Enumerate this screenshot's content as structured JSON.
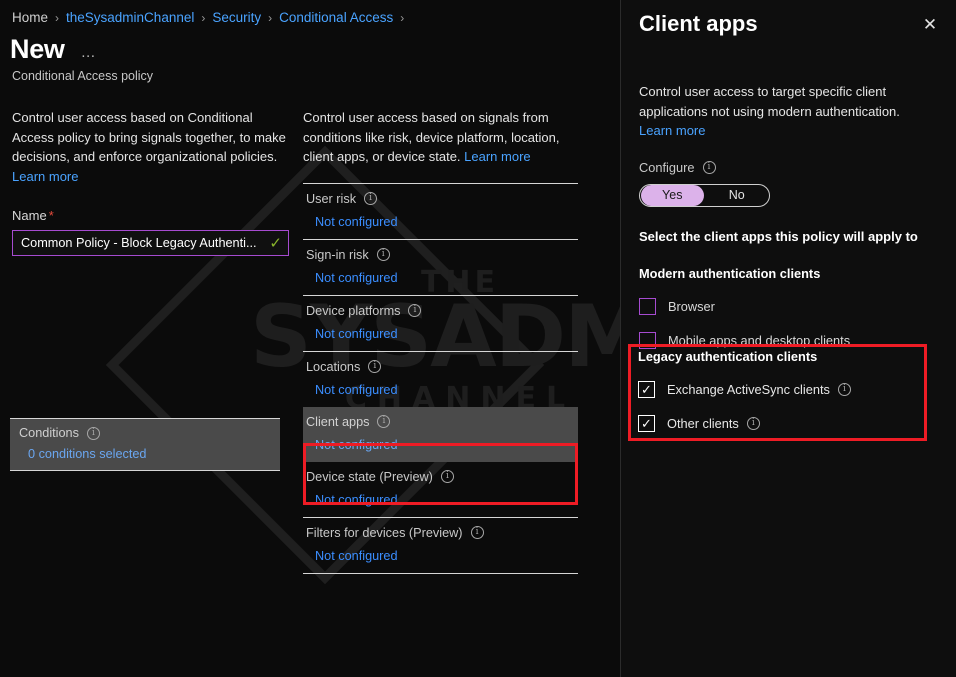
{
  "breadcrumb": {
    "items": [
      {
        "label": "Home",
        "type": "current"
      },
      {
        "label": "theSysadminChannel",
        "type": "link"
      },
      {
        "label": "Security",
        "type": "link"
      },
      {
        "label": "Conditional Access",
        "type": "link"
      }
    ],
    "separator": "›"
  },
  "page": {
    "title": "New",
    "subtitle": "Conditional Access policy",
    "overflow_menu": "…"
  },
  "left_column": {
    "intro": "Control user access based on Conditional Access policy to bring signals together, to make decisions, and enforce organizational policies.",
    "intro_link": "Learn more",
    "name_label": "Name",
    "name_required_mark": "*",
    "name_value": "Common Policy - Block Legacy Authenti...",
    "name_valid_icon": "✓",
    "conditions": {
      "title": "Conditions",
      "value": "0 conditions selected",
      "info_icon": "i"
    }
  },
  "middle_column": {
    "intro": "Control user access based on signals from conditions like risk, device platform, location, client apps, or device state.",
    "intro_link": "Learn more",
    "rows": [
      {
        "title": "User risk",
        "value": "Not configured",
        "selected": false
      },
      {
        "title": "Sign-in risk",
        "value": "Not configured",
        "selected": false
      },
      {
        "title": "Device platforms",
        "value": "Not configured",
        "selected": false
      },
      {
        "title": "Locations",
        "value": "Not configured",
        "selected": false
      },
      {
        "title": "Client apps",
        "value": "Not configured",
        "selected": true
      },
      {
        "title": "Device state (Preview)",
        "value": "Not configured",
        "selected": false
      },
      {
        "title": "Filters for devices (Preview)",
        "value": "Not configured",
        "selected": false
      }
    ]
  },
  "flyout": {
    "title": "Client apps",
    "close_icon": "✕",
    "description": "Control user access to target specific client applications not using modern authentication.",
    "description_link": "Learn more",
    "configure_label": "Configure",
    "configure_info_icon": "i",
    "toggle": {
      "options": [
        "Yes",
        "No"
      ],
      "selected": "Yes"
    },
    "select_heading": "Select the client apps this policy will apply to",
    "modern_group": {
      "heading": "Modern authentication clients",
      "items": [
        {
          "label": "Browser",
          "checked": false,
          "has_info": false
        },
        {
          "label": "Mobile apps and desktop clients",
          "checked": false,
          "has_info": false
        }
      ]
    },
    "legacy_group": {
      "heading": "Legacy authentication clients",
      "items": [
        {
          "label": "Exchange ActiveSync clients",
          "checked": true,
          "has_info": true
        },
        {
          "label": "Other clients",
          "checked": true,
          "has_info": true
        }
      ]
    },
    "checkmark": "✓"
  },
  "watermark": {
    "line1": "THE",
    "line2": "SYSADMIN",
    "line3": "CHANNEL"
  },
  "colors": {
    "background": "#0b0b0b",
    "link": "#4aa3ff",
    "accent_purple": "#a64bd0",
    "toggle_active": "#dcb2ea",
    "annotation_red": "#ee1c25",
    "valid_green": "#8ab62b",
    "selected_row": "#4a4a4a",
    "required_red": "#e74c3c"
  }
}
